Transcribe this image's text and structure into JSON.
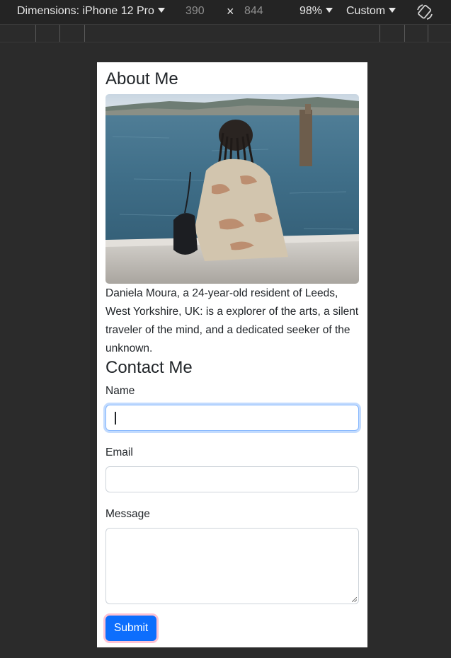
{
  "devtools": {
    "device_label": "Dimensions: iPhone 12 Pro",
    "width": "390",
    "times": "×",
    "height": "844",
    "zoom": "98%",
    "throttle": "Custom"
  },
  "about": {
    "title": "About Me",
    "bio": "Daniela Moura, a 24-year-old resident of Leeds, West Yorkshire, UK: is a explorer of the arts, a silent traveler of the mind, and a dedicated seeker of the unknown."
  },
  "contact": {
    "title": "Contact Me",
    "name_label": "Name",
    "name_value": "",
    "email_label": "Email",
    "email_value": "",
    "message_label": "Message",
    "message_value": "",
    "submit_label": "Submit"
  },
  "colors": {
    "primary": "#0d6efd",
    "focus_ring": "#86b7fe",
    "background": "#2b2b2b"
  }
}
